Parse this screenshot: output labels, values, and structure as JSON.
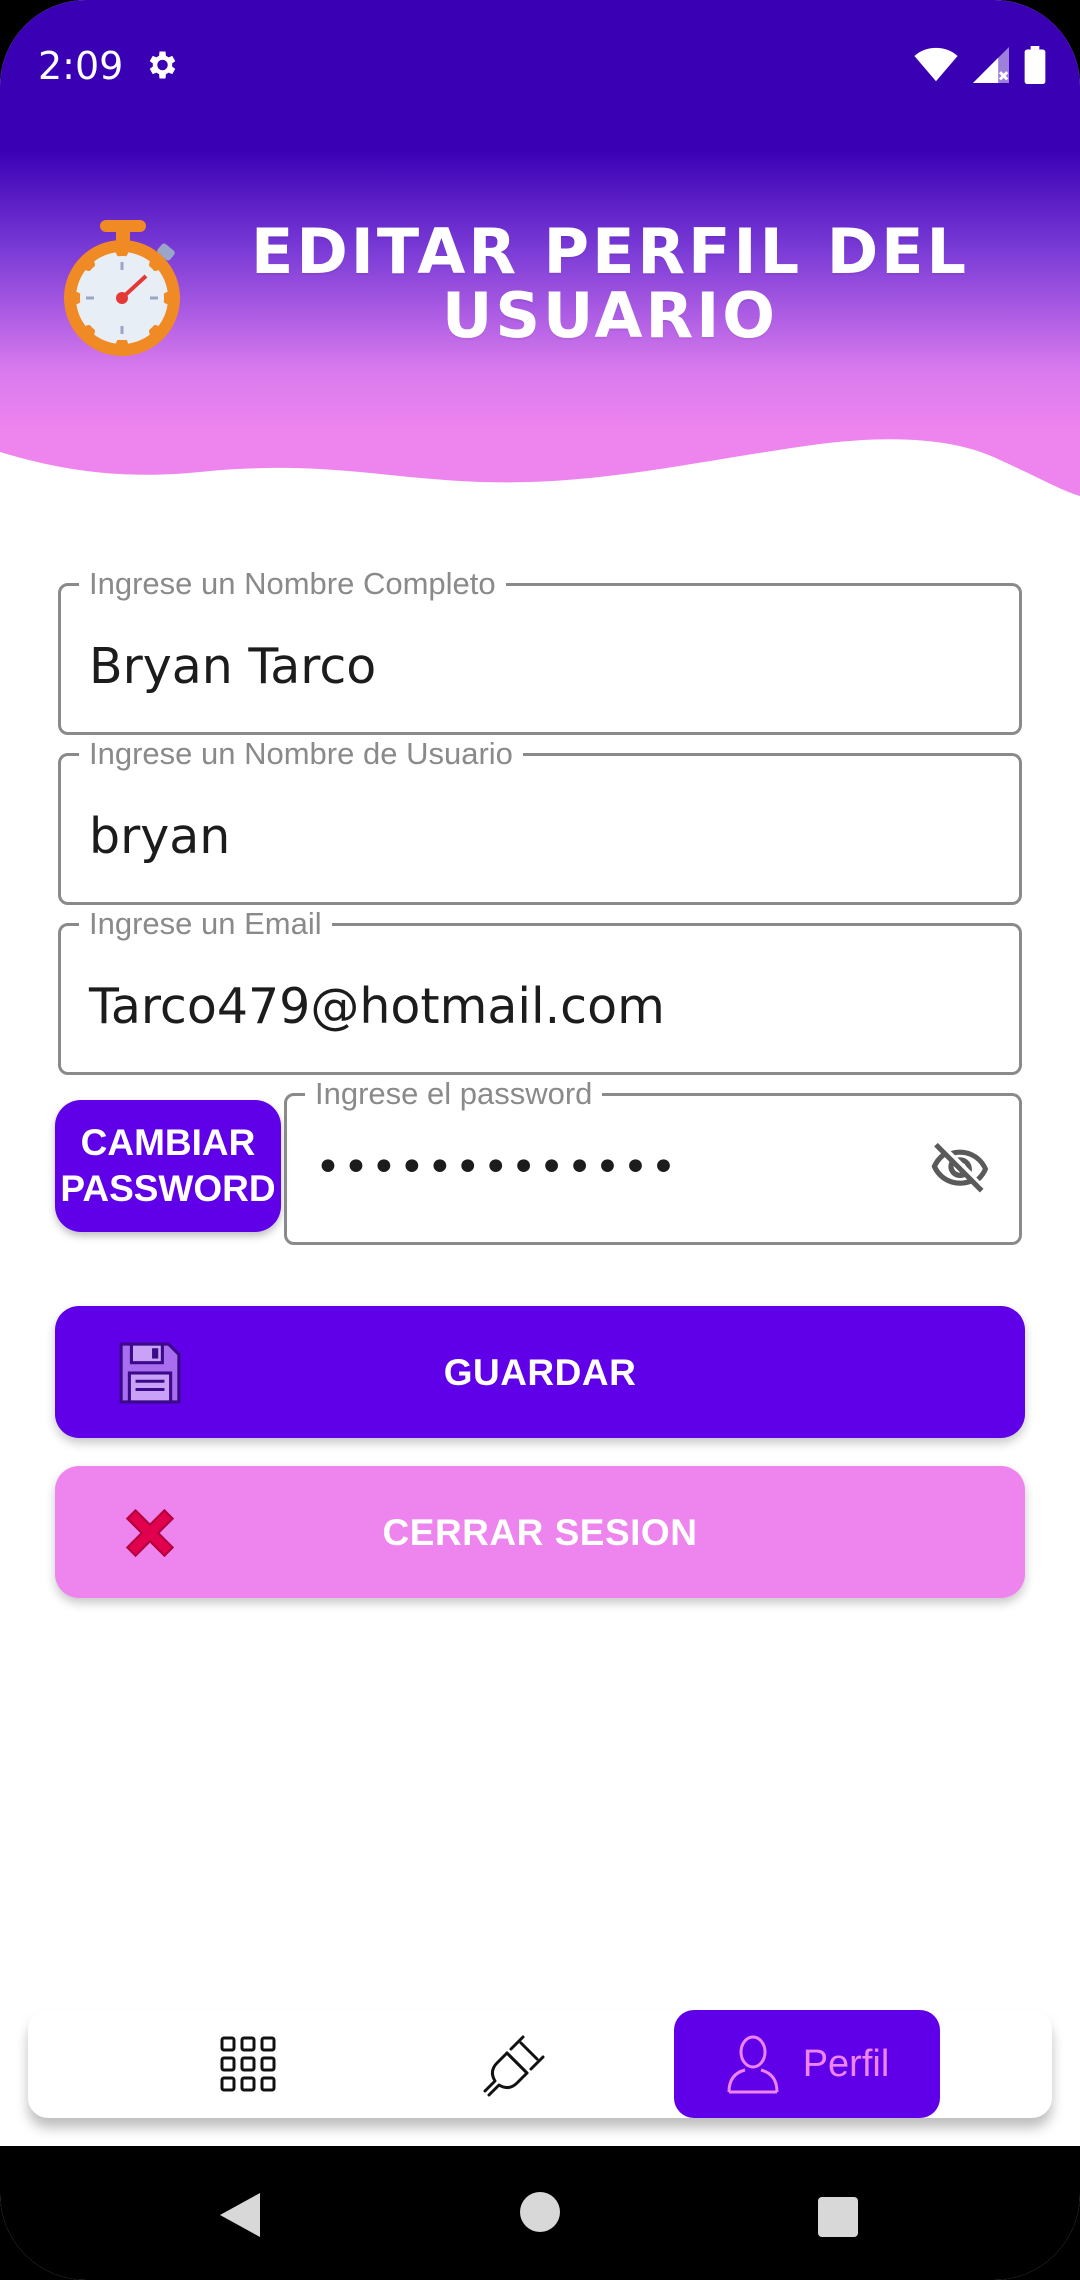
{
  "status_bar": {
    "time": "2:09"
  },
  "header": {
    "title": "EDITAR PERFIL DEL USUARIO"
  },
  "form": {
    "full_name": {
      "label": "Ingrese un Nombre Completo",
      "value": "Bryan Tarco"
    },
    "username": {
      "label": "Ingrese un Nombre de Usuario",
      "value": "bryan"
    },
    "email": {
      "label": "Ingrese un Email",
      "value": "Tarco479@hotmail.com"
    },
    "password": {
      "label": "Ingrese el password",
      "value": "•••••••••••••"
    }
  },
  "buttons": {
    "change_password_line1": "CAMBIAR",
    "change_password_line2": "PASSWORD",
    "save": "GUARDAR",
    "logout": "CERRAR SESION"
  },
  "bottom_nav": {
    "active_label": "Perfil"
  },
  "colors": {
    "primary": "#6000e8",
    "pink": "#ee84ee",
    "header_dark": "#3a00b4"
  },
  "icons": [
    "settings-icon",
    "wifi-icon",
    "signal-icon",
    "battery-icon",
    "stopwatch-icon",
    "eye-off-icon",
    "save-icon",
    "close-icon",
    "grid-icon",
    "plug-icon",
    "user-icon",
    "back-icon",
    "home-icon",
    "recents-icon"
  ]
}
